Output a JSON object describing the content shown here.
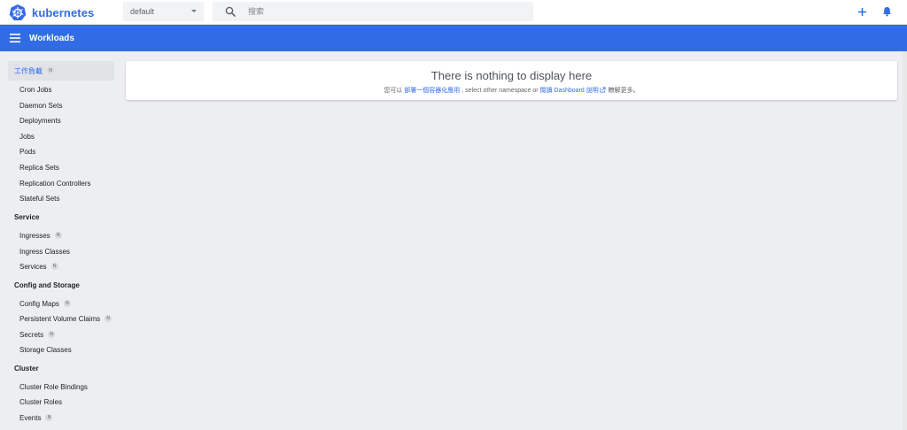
{
  "app": {
    "brand": "kubernetes"
  },
  "topbar": {
    "namespace_value": "default",
    "search_placeholder": "搜索"
  },
  "header": {
    "title": "Workloads"
  },
  "sidebar": {
    "workloads_group": {
      "label": "工作負載",
      "badge": "N"
    },
    "workload_items": [
      {
        "label": "Cron Jobs"
      },
      {
        "label": "Daemon Sets"
      },
      {
        "label": "Deployments"
      },
      {
        "label": "Jobs"
      },
      {
        "label": "Pods"
      },
      {
        "label": "Replica Sets"
      },
      {
        "label": "Replication Controllers"
      },
      {
        "label": "Stateful Sets"
      }
    ],
    "service_group": {
      "label": "Service"
    },
    "service_items": [
      {
        "label": "Ingresses",
        "badge": "N"
      },
      {
        "label": "Ingress Classes"
      },
      {
        "label": "Services",
        "badge": "N"
      }
    ],
    "config_group": {
      "label": "Config and Storage"
    },
    "config_items": [
      {
        "label": "Config Maps",
        "badge": "N"
      },
      {
        "label": "Persistent Volume Claims",
        "badge": "N"
      },
      {
        "label": "Secrets",
        "badge": "N"
      },
      {
        "label": "Storage Classes"
      }
    ],
    "cluster_group": {
      "label": "Cluster"
    },
    "cluster_items": [
      {
        "label": "Cluster Role Bindings"
      },
      {
        "label": "Cluster Roles"
      },
      {
        "label": "Events",
        "badge": "N"
      }
    ]
  },
  "main": {
    "empty_title": "There is nothing to display here",
    "empty_sub": {
      "prefix": "您可以",
      "link1": "部署一個容器化應用",
      "middle": ", select other namespace or",
      "link2": "閱讀 Dashboard 說明",
      "suffix": "瞭解更多。"
    }
  },
  "colors": {
    "brand_blue": "#326ce5",
    "background": "#edeef1"
  }
}
